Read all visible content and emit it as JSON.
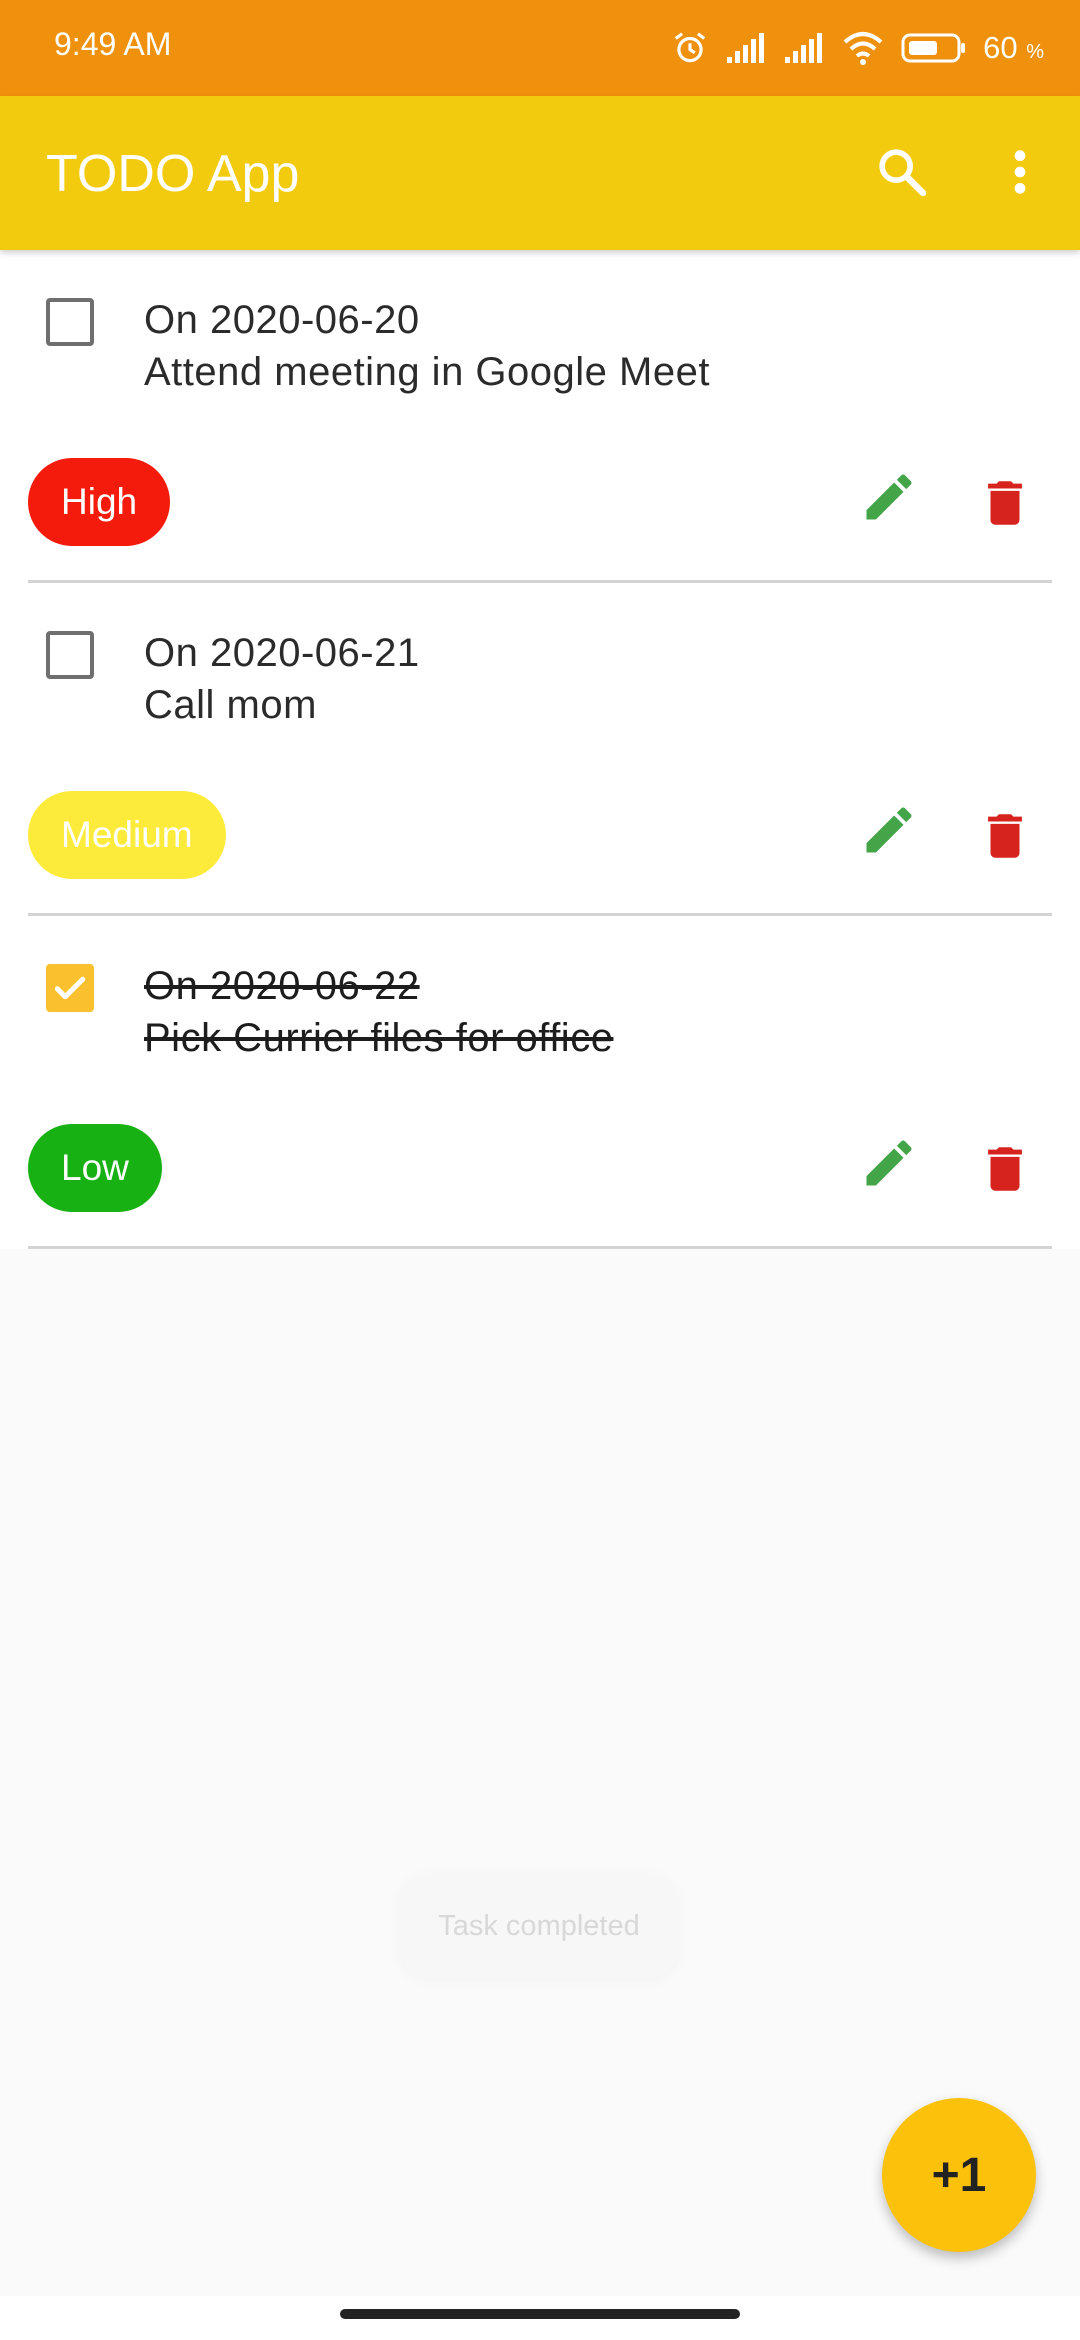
{
  "status_bar": {
    "time": "9:49 AM",
    "battery_percent": "60",
    "battery_unit": "%",
    "icons": [
      "alarm-icon",
      "signal-icon",
      "signal-icon",
      "wifi-icon",
      "battery-icon"
    ]
  },
  "app_bar": {
    "title": "TODO App",
    "actions": [
      "search-icon",
      "more-vert-icon"
    ]
  },
  "tasks": [
    {
      "date": "On 2020-06-20",
      "title": "Attend meeting in Google Meet",
      "priority": "High",
      "priority_color": "#f41b0c",
      "completed": false
    },
    {
      "date": "On 2020-06-21",
      "title": "Call mom",
      "priority": "Medium",
      "priority_color": "#fdeb3b",
      "completed": false
    },
    {
      "date": "On 2020-06-22",
      "title": "Pick Currier files for office",
      "priority": "Low",
      "priority_color": "#18b114",
      "completed": true
    }
  ],
  "toast": "Task completed",
  "fab_label": "+1",
  "colors": {
    "status_bar": "#ef910d",
    "app_bar": "#f2cb0f",
    "edit": "#43a548",
    "delete": "#d7231d",
    "checked": "#fbc02d",
    "fab": "#fbc10b"
  }
}
